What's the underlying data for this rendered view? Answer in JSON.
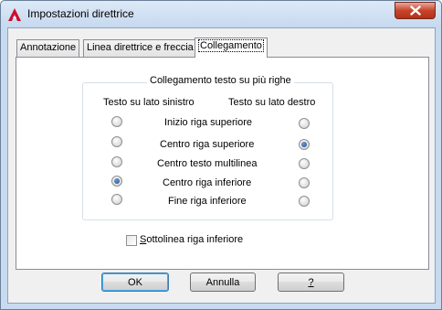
{
  "window": {
    "title": "Impostazioni direttrice"
  },
  "tabs": [
    {
      "label": "Annotazione",
      "active": false
    },
    {
      "label": "Linea direttrice e freccia",
      "active": false
    },
    {
      "label": "Collegamento",
      "active": true
    }
  ],
  "group": {
    "title": "Collegamento testo su più righe",
    "left_header": "Testo su lato sinistro",
    "right_header": "Testo su lato destro",
    "rows": [
      {
        "label": "Inizio riga superiore",
        "left_selected": false,
        "right_selected": false
      },
      {
        "label": "Centro riga superiore",
        "left_selected": false,
        "right_selected": true
      },
      {
        "label": "Centro testo multilinea",
        "left_selected": false,
        "right_selected": false
      },
      {
        "label": "Centro riga inferiore",
        "left_selected": true,
        "right_selected": false
      },
      {
        "label": "Fine riga inferiore",
        "left_selected": false,
        "right_selected": false
      }
    ]
  },
  "underline_option": {
    "label": "Sottolinea riga inferiore",
    "checked": false
  },
  "buttons": {
    "ok": "OK",
    "cancel": "Annulla",
    "help": "?"
  },
  "colors": {
    "accent": "#1d4f8e",
    "close_button": "#c7442a",
    "app_icon": "#c8102e"
  },
  "icons": {
    "app": "autocad-logo-icon",
    "close": "close-icon"
  }
}
